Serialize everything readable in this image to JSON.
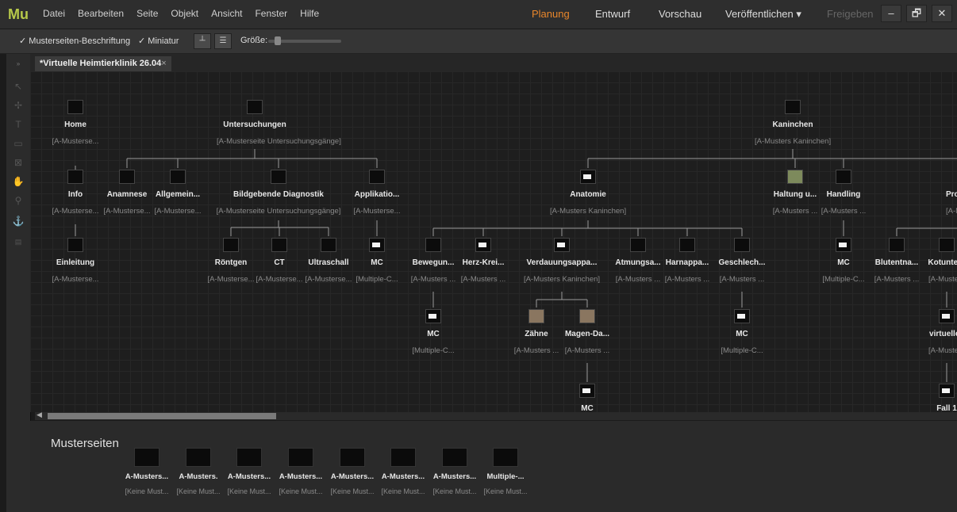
{
  "app": {
    "logo": "Mu"
  },
  "menu": [
    "Datei",
    "Bearbeiten",
    "Seite",
    "Objekt",
    "Ansicht",
    "Fenster",
    "Hilfe"
  ],
  "modes": [
    "Planung",
    "Entwurf",
    "Vorschau",
    "Veröffentlichen ▾",
    "Freigeben"
  ],
  "window_buttons": [
    "–",
    "🗗",
    "✕"
  ],
  "toolbar": {
    "master_caption_label": "Musterseiten-Beschriftung",
    "thumbnail_label": "Miniatur",
    "size_label": "Größe:"
  },
  "tab": {
    "title": "*Virtuelle Heimtierklinik 26.04",
    "close": "×"
  },
  "nodes": [
    {
      "label": "Home",
      "sub": "[A-Musterse...",
      "thumb": "photo"
    },
    {
      "label": "Untersuchungen",
      "sub": "[A-Musterseite Untersuchungsgänge]",
      "thumb": "dark"
    },
    {
      "label": "Kaninchen",
      "sub": "[A-Musters Kaninchen]",
      "thumb": "white"
    },
    {
      "label": "Info",
      "sub": "[A-Musterse...",
      "thumb": "dark"
    },
    {
      "label": "Anamnese",
      "sub": "[A-Musterse...",
      "thumb": "dark"
    },
    {
      "label": "Allgemein...",
      "sub": "[A-Musterse...",
      "thumb": "dark"
    },
    {
      "label": "Bildgebende Diagnostik",
      "sub": "[A-Musterseite Untersuchungsgänge]",
      "thumb": "dark"
    },
    {
      "label": "Applikatio...",
      "sub": "[A-Musterse...",
      "thumb": "dark"
    },
    {
      "label": "Anatomie",
      "sub": "[A-Musters Kaninchen]",
      "thumb": "white"
    },
    {
      "label": "Haltung u...",
      "sub": "[A-Musters ...",
      "thumb": "green"
    },
    {
      "label": "Handling",
      "sub": "[A-Musters ...",
      "thumb": "dark"
    },
    {
      "label": "Probe",
      "sub": "[A-Must",
      "thumb": "dark"
    },
    {
      "label": "Einleitung",
      "sub": "[A-Musterse...",
      "thumb": "dark"
    },
    {
      "label": "Röntgen",
      "sub": "[A-Musterse...",
      "thumb": "dark"
    },
    {
      "label": "CT",
      "sub": "[A-Musterse...",
      "thumb": "dark"
    },
    {
      "label": "Ultraschall",
      "sub": "[A-Musterse...",
      "thumb": "dark"
    },
    {
      "label": "MC",
      "sub": "[Multiple-C...",
      "thumb": "white"
    },
    {
      "label": "Bewegun...",
      "sub": "[A-Musters ...",
      "thumb": "dark"
    },
    {
      "label": "Herz-Krei...",
      "sub": "[A-Musters ...",
      "thumb": "white"
    },
    {
      "label": "Verdauungsappa...",
      "sub": "[A-Musters Kaninchen]",
      "thumb": "white"
    },
    {
      "label": "Atmungsa...",
      "sub": "[A-Musters ...",
      "thumb": "dark"
    },
    {
      "label": "Harnappa...",
      "sub": "[A-Musters ...",
      "thumb": "dark"
    },
    {
      "label": "Geschlech...",
      "sub": "[A-Musters ...",
      "thumb": "dark"
    },
    {
      "label": "MC",
      "sub": "[Multiple-C...",
      "thumb": "white"
    },
    {
      "label": "Blutentna...",
      "sub": "[A-Musters ...",
      "thumb": "dark"
    },
    {
      "label": "Kotunters",
      "sub": "[A-Musters",
      "thumb": "dark"
    },
    {
      "label": "MC",
      "sub": "[Multiple-C...",
      "thumb": "white"
    },
    {
      "label": "Zähne",
      "sub": "[A-Musters ...",
      "thumb": "photo"
    },
    {
      "label": "Magen-Da...",
      "sub": "[A-Musters ...",
      "thumb": "photo"
    },
    {
      "label": "MC",
      "sub": "[Multiple-C...",
      "thumb": "white"
    },
    {
      "label": "virtuelles",
      "sub": "[A-Musters",
      "thumb": "white"
    },
    {
      "label": "MC",
      "sub": "",
      "thumb": "white"
    },
    {
      "label": "Fall 1",
      "sub": "",
      "thumb": "white"
    }
  ],
  "masters": {
    "title": "Musterseiten",
    "items": [
      {
        "label": "A-Musters...",
        "sub": "[Keine Must..."
      },
      {
        "label": "A-Musters.",
        "sub": "[Keine Must..."
      },
      {
        "label": "A-Musters...",
        "sub": "[Keine Must..."
      },
      {
        "label": "A-Musters...",
        "sub": "[Keine Must..."
      },
      {
        "label": "A-Musters...",
        "sub": "[Keine Must..."
      },
      {
        "label": "A-Musters...",
        "sub": "[Keine Must..."
      },
      {
        "label": "A-Musters...",
        "sub": "[Keine Must..."
      },
      {
        "label": "Multiple-...",
        "sub": "[Keine Must..."
      }
    ]
  }
}
